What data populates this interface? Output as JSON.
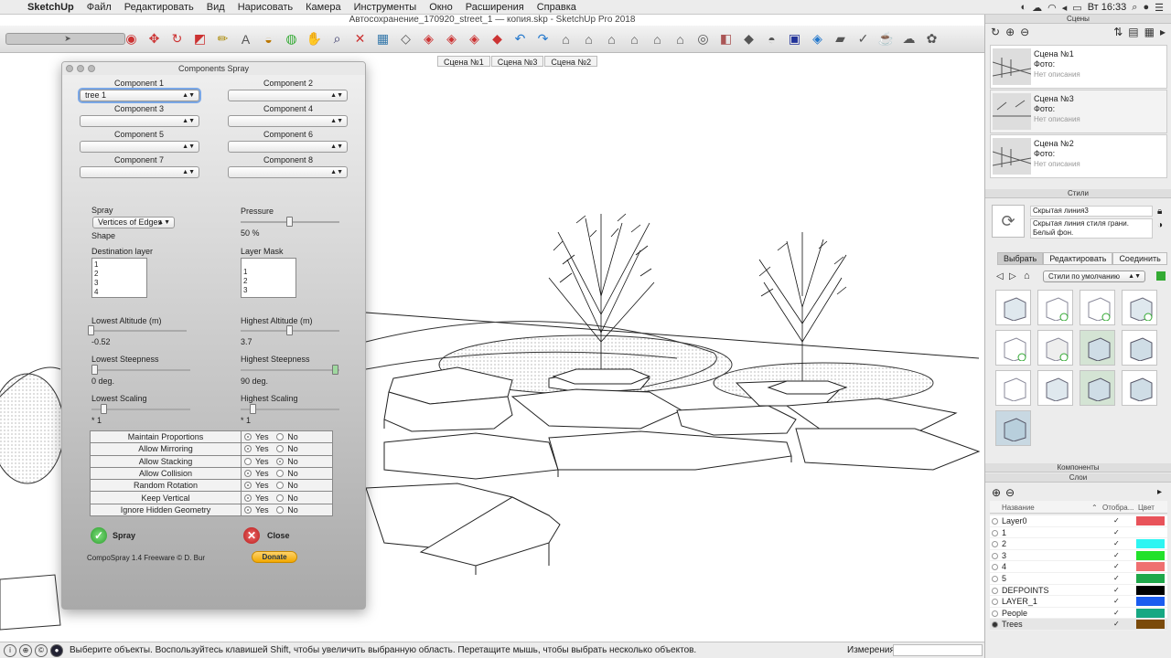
{
  "menubar": {
    "app": "SketchUp",
    "items": [
      "Файл",
      "Редактировать",
      "Вид",
      "Нарисовать",
      "Камера",
      "Инструменты",
      "Окно",
      "Расширения",
      "Справка"
    ],
    "clock": "Вт 16:33"
  },
  "window": {
    "title": "Автосохранение_170920_street_1 — копия.skp - SketchUp Pro 2018"
  },
  "scene_tabs": [
    "Сцена №1",
    "Сцена №3",
    "Сцена №2"
  ],
  "status": {
    "message": "Выберите объекты. Воспользуйтесь клавишей Shift, чтобы увеличить выбранную область. Перетащите мышь, чтобы выбрать несколько объектов.",
    "measure_label": "Измерения"
  },
  "dialog": {
    "title": "Components Spray",
    "components": [
      {
        "label": "Component 1",
        "value": "tree 1"
      },
      {
        "label": "Component 2",
        "value": ""
      },
      {
        "label": "Component 3",
        "value": ""
      },
      {
        "label": "Component 4",
        "value": ""
      },
      {
        "label": "Component 5",
        "value": ""
      },
      {
        "label": "Component 6",
        "value": ""
      },
      {
        "label": "Component 7",
        "value": ""
      },
      {
        "label": "Component 8",
        "value": ""
      }
    ],
    "spray_label": "Spray",
    "spray_mode": "Vertices of Edges",
    "shape_label": "Shape",
    "pressure_label": "Pressure",
    "pressure_value": "50 %",
    "pressure_fraction": 0.5,
    "dest_layer_label": "Destination layer",
    "dest_layers": [
      "1",
      "2",
      "3",
      "4"
    ],
    "layer_mask_label": "Layer Mask",
    "mask_layers": [
      "1",
      "2",
      "3"
    ],
    "lowest_altitude_label": "Lowest Altitude (m)",
    "lowest_altitude": "-0.52",
    "highest_altitude_label": "Highest Altitude (m)",
    "highest_altitude": "3.7",
    "lowest_steepness_label": "Lowest Steepness",
    "lowest_steepness": "0 deg.",
    "highest_steepness_label": "Highest Steepness",
    "highest_steepness": "90 deg.",
    "lowest_scaling_label": "Lowest Scaling",
    "lowest_scaling": "* 1",
    "highest_scaling_label": "Highest Scaling",
    "highest_scaling": "* 1",
    "options": [
      {
        "label": "Maintain Proportions",
        "yes": true
      },
      {
        "label": "Allow Mirroring",
        "yes": true
      },
      {
        "label": "Allow Stacking",
        "yes": false
      },
      {
        "label": "Allow Collision",
        "yes": true
      },
      {
        "label": "Random Rotation",
        "yes": true
      },
      {
        "label": "Keep Vertical",
        "yes": true
      },
      {
        "label": "Ignore Hidden Geometry",
        "yes": true
      }
    ],
    "yes_label": "Yes",
    "no_label": "No",
    "spray_button": "Spray",
    "close_button": "Close",
    "footer": "CompoSpray 1.4 Freeware © D. Bur",
    "donate": "Donate"
  },
  "panels": {
    "scenes_header": "Сцены",
    "scenes": [
      {
        "name": "Сцена №1",
        "photo": "Фото:",
        "desc": "Нет описания"
      },
      {
        "name": "Сцена №3",
        "photo": "Фото:",
        "desc": "Нет описания"
      },
      {
        "name": "Сцена №2",
        "photo": "Фото:",
        "desc": "Нет описания"
      }
    ],
    "styles_header": "Стили",
    "style_name": "Скрытая линия3",
    "style_desc": "Скрытая линия стиля грани. Белый фон.",
    "style_tabs": [
      "Выбрать",
      "Редактировать",
      "Соединить"
    ],
    "style_collection": "Стили по умолчанию",
    "components_header": "Компоненты",
    "layers_header": "Слои",
    "layer_cols": {
      "name": "Название",
      "visible": "Отобра...",
      "color": "Цвет"
    },
    "layers": [
      {
        "name": "Layer0",
        "color": "#e8535a",
        "active": false
      },
      {
        "name": "1",
        "color": "#ffffff",
        "active": false
      },
      {
        "name": "2",
        "color": "#2ef5f2",
        "active": false
      },
      {
        "name": "3",
        "color": "#22e12a",
        "active": false
      },
      {
        "name": "4",
        "color": "#ef7070",
        "active": false
      },
      {
        "name": "5",
        "color": "#1fa84a",
        "active": false
      },
      {
        "name": "DEFPOINTS",
        "color": "#000000",
        "active": false
      },
      {
        "name": "LAYER_1",
        "color": "#1a5cf0",
        "active": false
      },
      {
        "name": "People",
        "color": "#17a883",
        "active": false
      },
      {
        "name": "Trees",
        "color": "#7a4a0a",
        "active": true
      }
    ]
  }
}
